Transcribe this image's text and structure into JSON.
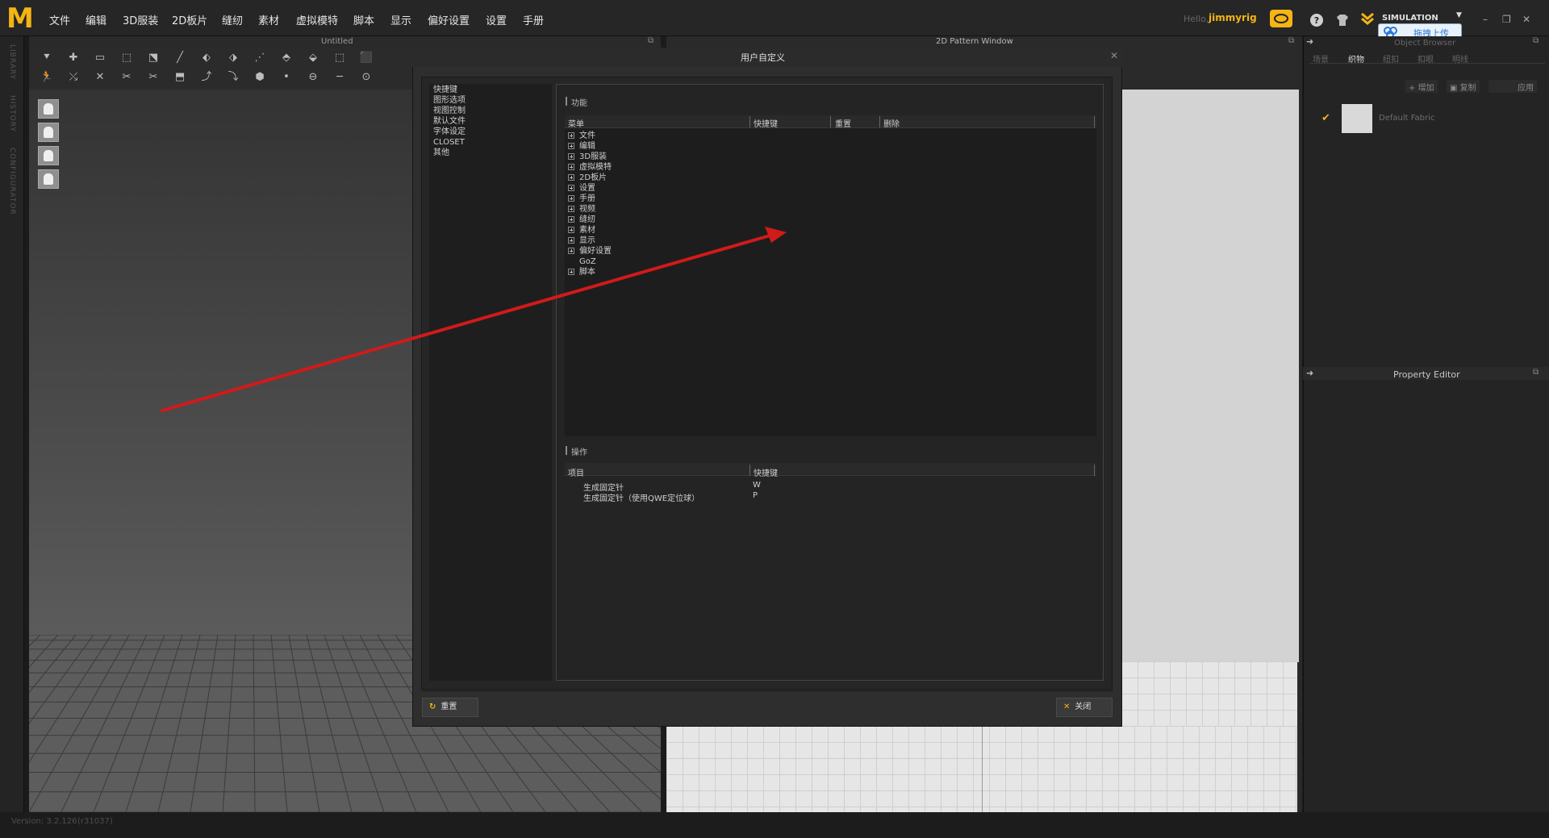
{
  "app": {
    "logo": "M",
    "menu": [
      "文件",
      "编辑",
      "3D服装",
      "2D板片",
      "缝纫",
      "素材",
      "虚拟模特",
      "脚本",
      "显示",
      "偏好设置",
      "设置",
      "手册"
    ],
    "hello": "Hello,",
    "username": "jimmyrig",
    "mode": "SIMULATION",
    "upload_label": "拖拽上传",
    "brand_color": "#f3b415"
  },
  "left_tabs": [
    "LIBRARY",
    "HISTORY",
    "CONFIGURATOR"
  ],
  "view3d": {
    "title": "Untitled"
  },
  "panel2d": {
    "title": "2D Pattern Window"
  },
  "object_browser": {
    "title": "Object Browser",
    "tabs": [
      "场景",
      "织物",
      "纽扣",
      "扣眼",
      "明线"
    ],
    "active_tab": "织物",
    "add_label": "增加",
    "copy_label": "复制",
    "apply_label": "应用",
    "fabric_name": "Default Fabric"
  },
  "property_editor": {
    "title": "Property Editor"
  },
  "status": {
    "version": "Version: 3.2.126",
    "build": "(r31037)"
  },
  "dialog": {
    "title": "用户自定义",
    "categories": [
      "快捷键",
      "图形选项",
      "视图控制",
      "默认文件",
      "字体设定",
      "CLOSET",
      "其他"
    ],
    "function_section": "功能",
    "function_columns": [
      "菜单",
      "快捷键",
      "重置",
      "删除"
    ],
    "function_rows": [
      {
        "label": "文件",
        "expandable": true
      },
      {
        "label": "编辑",
        "expandable": true
      },
      {
        "label": "3D服装",
        "expandable": true
      },
      {
        "label": "虚拟模特",
        "expandable": true
      },
      {
        "label": "2D板片",
        "expandable": true
      },
      {
        "label": "设置",
        "expandable": true
      },
      {
        "label": "手册",
        "expandable": true
      },
      {
        "label": "视频",
        "expandable": true
      },
      {
        "label": "缝纫",
        "expandable": true
      },
      {
        "label": "素材",
        "expandable": true
      },
      {
        "label": "显示",
        "expandable": true
      },
      {
        "label": "偏好设置",
        "expandable": true
      },
      {
        "label": "GoZ",
        "expandable": false
      },
      {
        "label": "脚本",
        "expandable": true
      }
    ],
    "ops_section": "操作",
    "ops_columns": [
      "项目",
      "快捷键"
    ],
    "ops_rows": [
      {
        "item": "生成固定针",
        "key": "W"
      },
      {
        "item": "生成固定针（使用QWE定位球）",
        "key": "P"
      }
    ],
    "reset_label": "重置",
    "close_label": "关闭"
  },
  "annotation_color": "#d11a1a"
}
